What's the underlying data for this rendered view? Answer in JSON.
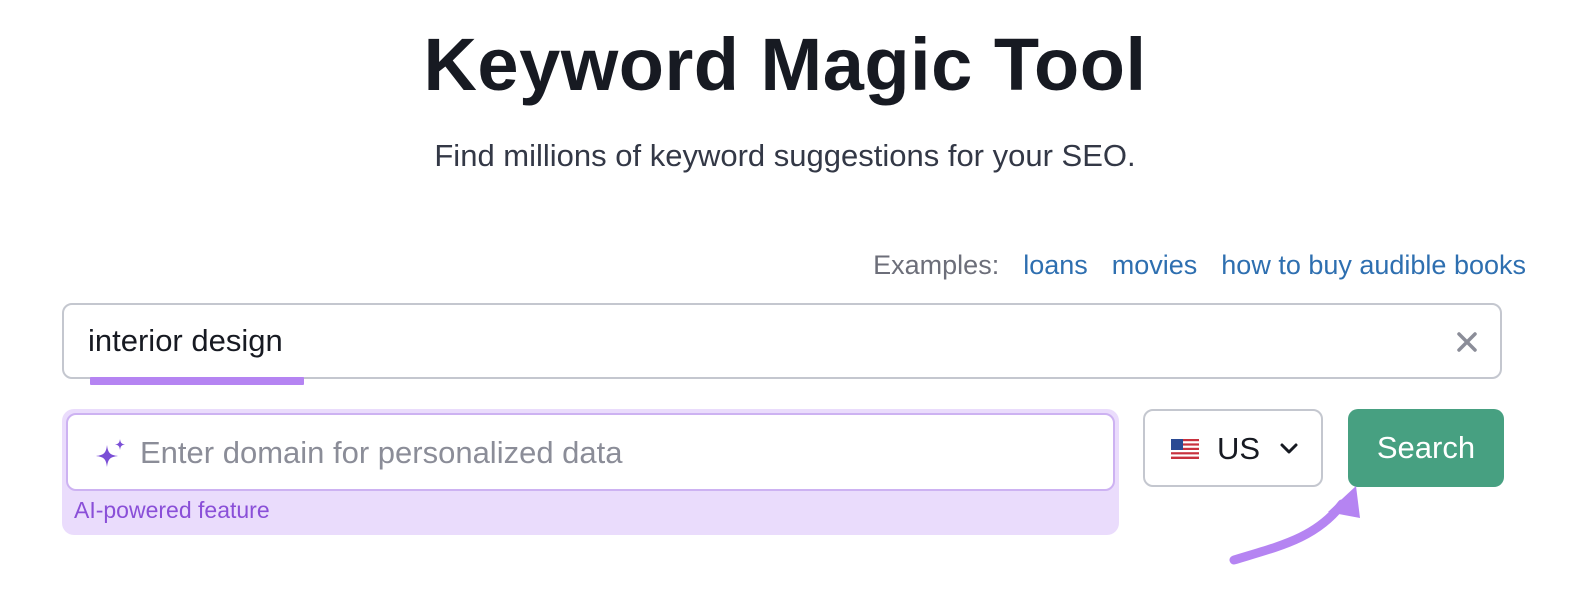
{
  "header": {
    "title": "Keyword Magic Tool",
    "subtitle": "Find millions of keyword suggestions for your SEO."
  },
  "examples": {
    "label": "Examples:",
    "items": [
      "loans",
      "movies",
      "how to buy audible books"
    ]
  },
  "keyword_input": {
    "value": "interior design",
    "clear_icon": "close-icon"
  },
  "domain_input": {
    "placeholder": "Enter domain for personalized data",
    "icon": "sparkle-icon",
    "feature_label": "AI-powered feature"
  },
  "country_select": {
    "selected": "US",
    "flag_icon": "us-flag-icon",
    "chevron_icon": "chevron-down-icon"
  },
  "search_button": {
    "label": "Search"
  },
  "colors": {
    "accent_green": "#47a081",
    "ai_purple": "#eadcfc",
    "highlight_purple": "#b584f2",
    "link_blue": "#2e6fb0"
  }
}
